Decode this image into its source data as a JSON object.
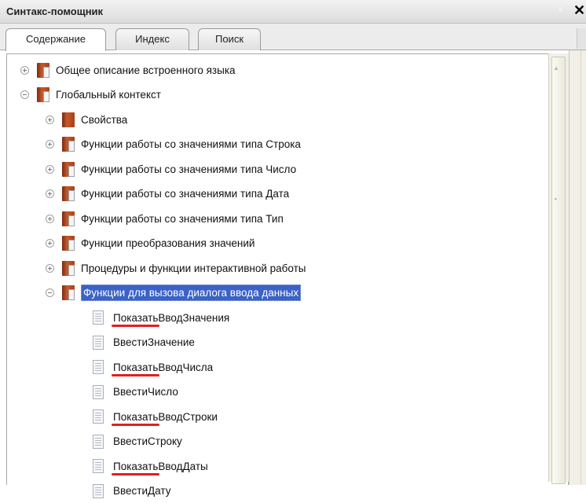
{
  "window": {
    "title": "Синтакс-помощник",
    "pin_glyph": "ᵍ",
    "close_glyph": "✕"
  },
  "tabs": [
    {
      "label": "Содержание",
      "active": true
    },
    {
      "label": "Индекс",
      "active": false
    },
    {
      "label": "Поиск",
      "active": false
    }
  ],
  "tree": {
    "items": [
      {
        "label": "Общее описание встроенного языка",
        "expander": "plus",
        "icon": "book-open-icon"
      },
      {
        "label": "Глобальный контекст",
        "expander": "minus",
        "icon": "book-open-icon"
      },
      {
        "label": "Свойства",
        "expander": "plus",
        "icon": "book-closed-icon"
      },
      {
        "label": "Функции работы со значениями типа Строка",
        "expander": "plus",
        "icon": "book-open-icon"
      },
      {
        "label": "Функции работы со значениями типа Число",
        "expander": "plus",
        "icon": "book-open-icon"
      },
      {
        "label": "Функции работы со значениями типа Дата",
        "expander": "plus",
        "icon": "book-open-icon"
      },
      {
        "label": "Функции работы со значениями типа Тип",
        "expander": "plus",
        "icon": "book-open-icon"
      },
      {
        "label": "Функции преобразования значений",
        "expander": "plus",
        "icon": "book-open-icon"
      },
      {
        "label": "Процедуры и функции интерактивной работы",
        "expander": "plus",
        "icon": "book-open-icon"
      },
      {
        "label": "Функции для вызова диалога ввода данных",
        "expander": "minus",
        "icon": "book-open-icon",
        "selected": true
      },
      {
        "prefix": "Показать",
        "rest": "ВводЗначения",
        "icon": "document-icon",
        "underlined": true
      },
      {
        "label": "ВвестиЗначение",
        "icon": "document-icon"
      },
      {
        "prefix": "Показать",
        "rest": "ВводЧисла",
        "icon": "document-icon",
        "underlined": true
      },
      {
        "label": "ВвестиЧисло",
        "icon": "document-icon"
      },
      {
        "prefix": "Показать",
        "rest": "ВводСтроки",
        "icon": "document-icon",
        "underlined": true
      },
      {
        "label": "ВвестиСтроку",
        "icon": "document-icon"
      },
      {
        "prefix": "Показать",
        "rest": "ВводДаты",
        "icon": "document-icon",
        "underlined": true
      },
      {
        "label": "ВвестиДату",
        "icon": "document-icon"
      }
    ]
  },
  "colors": {
    "selection": "#3b62c4",
    "underline": "#e02020"
  }
}
